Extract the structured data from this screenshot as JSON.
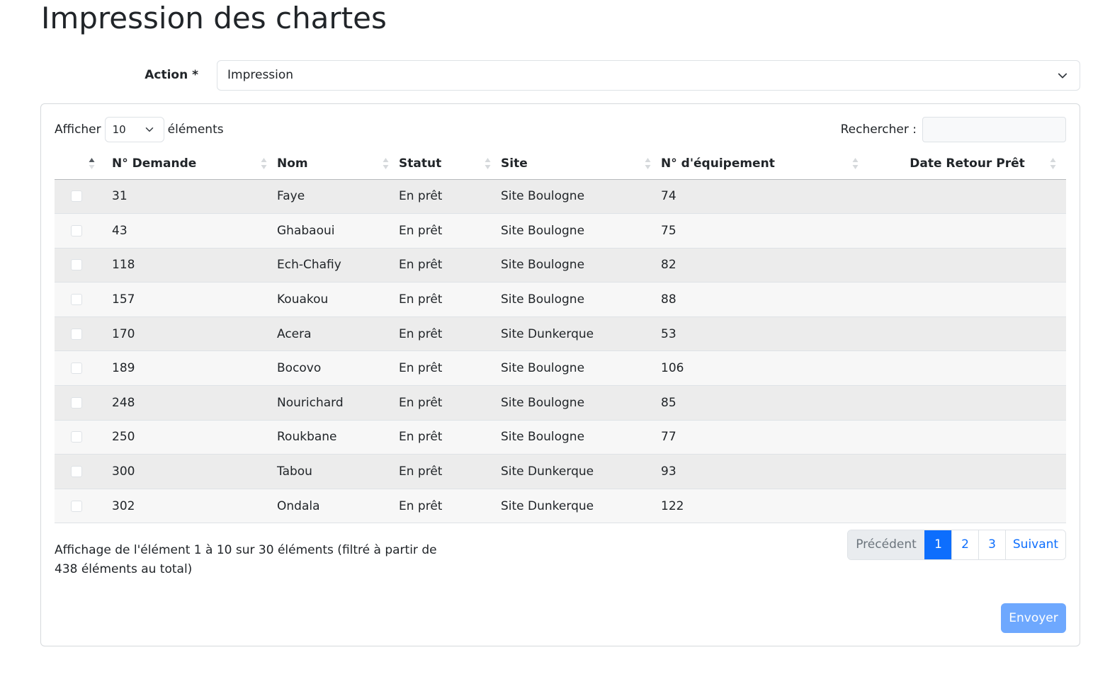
{
  "page": {
    "title": "Impression des chartes"
  },
  "action": {
    "label": "Action *",
    "value": "Impression"
  },
  "table_controls": {
    "show_label": "Afficher",
    "show_value": "10",
    "show_suffix": "éléments",
    "search_label": "Rechercher :"
  },
  "columns": [
    "N° Demande",
    "Nom",
    "Statut",
    "Site",
    "N° d'équipement",
    "Date Retour Prêt"
  ],
  "rows": [
    {
      "id": "31",
      "nom": "Faye",
      "statut": "En prêt",
      "site": "Site Boulogne",
      "equip": "74",
      "date": ""
    },
    {
      "id": "43",
      "nom": "Ghabaoui",
      "statut": "En prêt",
      "site": "Site Boulogne",
      "equip": "75",
      "date": ""
    },
    {
      "id": "118",
      "nom": "Ech-Chafiy",
      "statut": "En prêt",
      "site": "Site Boulogne",
      "equip": "82",
      "date": ""
    },
    {
      "id": "157",
      "nom": "Kouakou",
      "statut": "En prêt",
      "site": "Site Boulogne",
      "equip": "88",
      "date": ""
    },
    {
      "id": "170",
      "nom": "Acera",
      "statut": "En prêt",
      "site": "Site Dunkerque",
      "equip": "53",
      "date": ""
    },
    {
      "id": "189",
      "nom": "Bocovo",
      "statut": "En prêt",
      "site": "Site Boulogne",
      "equip": "106",
      "date": ""
    },
    {
      "id": "248",
      "nom": "Nourichard",
      "statut": "En prêt",
      "site": "Site Boulogne",
      "equip": "85",
      "date": ""
    },
    {
      "id": "250",
      "nom": "Roukbane",
      "statut": "En prêt",
      "site": "Site Boulogne",
      "equip": "77",
      "date": ""
    },
    {
      "id": "300",
      "nom": "Tabou",
      "statut": "En prêt",
      "site": "Site Dunkerque",
      "equip": "93",
      "date": ""
    },
    {
      "id": "302",
      "nom": "Ondala",
      "statut": "En prêt",
      "site": "Site Dunkerque",
      "equip": "122",
      "date": ""
    }
  ],
  "info": "Affichage de l'élément 1 à 10 sur 30 éléments (filtré à partir de 438 éléments au total)",
  "pagination": {
    "previous": "Précédent",
    "pages": [
      "1",
      "2",
      "3"
    ],
    "active_page": "1",
    "next": "Suivant"
  },
  "send_button": "Envoyer",
  "colors": {
    "primary": "#0d6efd",
    "primary_disabled": "#6ea8fe",
    "row_odd": "#ececec",
    "row_even": "#f7f7f7"
  }
}
